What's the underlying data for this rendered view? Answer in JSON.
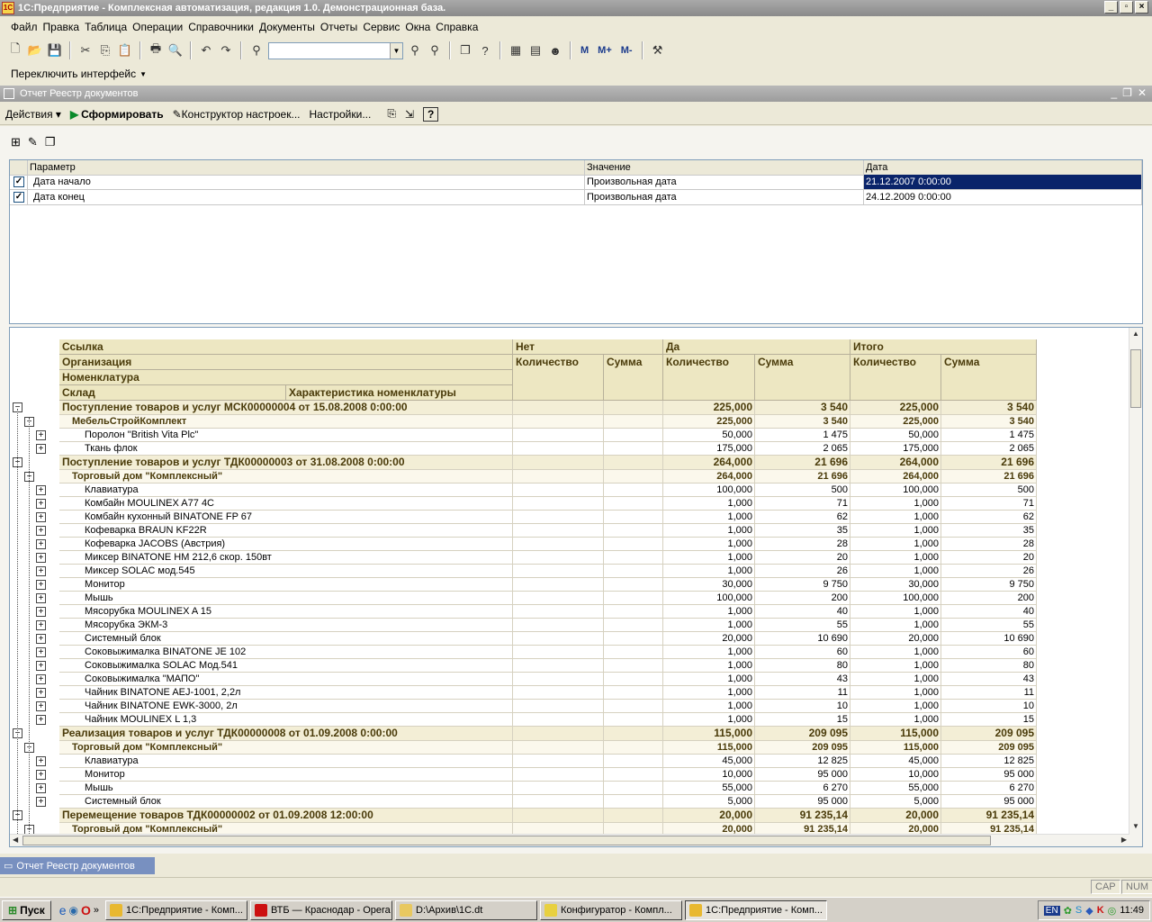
{
  "window": {
    "title": "1С:Предприятие - Комплексная автоматизация, редакция 1.0. Демонстрационная база.",
    "icon_text": "1C"
  },
  "menu": [
    "Файл",
    "Правка",
    "Таблица",
    "Операции",
    "Справочники",
    "Документы",
    "Отчеты",
    "Сервис",
    "Окна",
    "Справка"
  ],
  "toolbar": {
    "search_value": "",
    "m_buttons": [
      "M",
      "M+",
      "M-"
    ],
    "switch_interface": "Переключить интерфейс"
  },
  "subwindow": {
    "title": "Отчет  Реестр документов"
  },
  "actions": {
    "actions": "Действия",
    "generate": "Сформировать",
    "constructor": "Конструктор настроек...",
    "settings": "Настройки...",
    "help": "?"
  },
  "params": {
    "headers": [
      "Параметр",
      "Значение",
      "Дата"
    ],
    "rows": [
      {
        "checked": true,
        "name": "Дата начало",
        "value": "Произвольная дата",
        "date": "21.12.2007 0:00:00"
      },
      {
        "checked": true,
        "name": "Дата конец",
        "value": "Произвольная дата",
        "date": "24.12.2009 0:00:00"
      }
    ]
  },
  "report": {
    "headers": {
      "link": "Ссылка",
      "org": "Организация",
      "nom": "Номенклатура",
      "store": "Склад",
      "char": "Характеристика номенклатуры",
      "no": "Нет",
      "yes": "Да",
      "total": "Итого",
      "qty": "Количество",
      "sum": "Сумма"
    },
    "rows": [
      {
        "lvl": 0,
        "t": "Поступление товаров и услуг МСК00000004 от 15.08.2008 0:00:00",
        "n1": "",
        "s1": "",
        "n2": "225,000",
        "s2": "3 540",
        "n3": "225,000",
        "s3": "3 540"
      },
      {
        "lvl": 1,
        "t": "МебельСтройКомплект",
        "n1": "",
        "s1": "",
        "n2": "225,000",
        "s2": "3 540",
        "n3": "225,000",
        "s3": "3 540"
      },
      {
        "lvl": 2,
        "t": "Поролон \"British Vita Plc\"",
        "n1": "",
        "s1": "",
        "n2": "50,000",
        "s2": "1 475",
        "n3": "50,000",
        "s3": "1 475"
      },
      {
        "lvl": 2,
        "t": "Ткань флок",
        "n1": "",
        "s1": "",
        "n2": "175,000",
        "s2": "2 065",
        "n3": "175,000",
        "s3": "2 065"
      },
      {
        "lvl": 0,
        "t": "Поступление товаров и услуг ТДК00000003 от 31.08.2008 0:00:00",
        "n1": "",
        "s1": "",
        "n2": "264,000",
        "s2": "21 696",
        "n3": "264,000",
        "s3": "21 696"
      },
      {
        "lvl": 1,
        "t": "Торговый дом \"Комплексный\"",
        "n1": "",
        "s1": "",
        "n2": "264,000",
        "s2": "21 696",
        "n3": "264,000",
        "s3": "21 696"
      },
      {
        "lvl": 2,
        "t": "Клавиатура",
        "n1": "",
        "s1": "",
        "n2": "100,000",
        "s2": "500",
        "n3": "100,000",
        "s3": "500"
      },
      {
        "lvl": 2,
        "t": "Комбайн MOULINEX  A77 4C",
        "n1": "",
        "s1": "",
        "n2": "1,000",
        "s2": "71",
        "n3": "1,000",
        "s3": "71"
      },
      {
        "lvl": 2,
        "t": "Комбайн кухонный BINATONE FP 67",
        "n1": "",
        "s1": "",
        "n2": "1,000",
        "s2": "62",
        "n3": "1,000",
        "s3": "62"
      },
      {
        "lvl": 2,
        "t": "Кофеварка BRAUN KF22R",
        "n1": "",
        "s1": "",
        "n2": "1,000",
        "s2": "35",
        "n3": "1,000",
        "s3": "35"
      },
      {
        "lvl": 2,
        "t": "Кофеварка JACOBS (Австрия)",
        "n1": "",
        "s1": "",
        "n2": "1,000",
        "s2": "28",
        "n3": "1,000",
        "s3": "28"
      },
      {
        "lvl": 2,
        "t": "Миксер BINATONE HM 212,6 скор. 150вт",
        "n1": "",
        "s1": "",
        "n2": "1,000",
        "s2": "20",
        "n3": "1,000",
        "s3": "20"
      },
      {
        "lvl": 2,
        "t": "Миксер SOLAC мод.545",
        "n1": "",
        "s1": "",
        "n2": "1,000",
        "s2": "26",
        "n3": "1,000",
        "s3": "26"
      },
      {
        "lvl": 2,
        "t": "Монитор",
        "n1": "",
        "s1": "",
        "n2": "30,000",
        "s2": "9 750",
        "n3": "30,000",
        "s3": "9 750"
      },
      {
        "lvl": 2,
        "t": "Мышь",
        "n1": "",
        "s1": "",
        "n2": "100,000",
        "s2": "200",
        "n3": "100,000",
        "s3": "200"
      },
      {
        "lvl": 2,
        "t": "Мясорубка MOULINEX  A 15",
        "n1": "",
        "s1": "",
        "n2": "1,000",
        "s2": "40",
        "n3": "1,000",
        "s3": "40"
      },
      {
        "lvl": 2,
        "t": "Мясорубка ЭКМ-3",
        "n1": "",
        "s1": "",
        "n2": "1,000",
        "s2": "55",
        "n3": "1,000",
        "s3": "55"
      },
      {
        "lvl": 2,
        "t": "Системный блок",
        "n1": "",
        "s1": "",
        "n2": "20,000",
        "s2": "10 690",
        "n3": "20,000",
        "s3": "10 690"
      },
      {
        "lvl": 2,
        "t": "Соковыжималка  BINATONE JE 102",
        "n1": "",
        "s1": "",
        "n2": "1,000",
        "s2": "60",
        "n3": "1,000",
        "s3": "60"
      },
      {
        "lvl": 2,
        "t": "Соковыжималка  SOLAC  Мод.541",
        "n1": "",
        "s1": "",
        "n2": "1,000",
        "s2": "80",
        "n3": "1,000",
        "s3": "80"
      },
      {
        "lvl": 2,
        "t": "Соковыжималка \"МАПО\"",
        "n1": "",
        "s1": "",
        "n2": "1,000",
        "s2": "43",
        "n3": "1,000",
        "s3": "43"
      },
      {
        "lvl": 2,
        "t": "Чайник BINATONE  AEJ-1001,  2,2л",
        "n1": "",
        "s1": "",
        "n2": "1,000",
        "s2": "11",
        "n3": "1,000",
        "s3": "11"
      },
      {
        "lvl": 2,
        "t": "Чайник BINATONE  EWK-3000,  2л",
        "n1": "",
        "s1": "",
        "n2": "1,000",
        "s2": "10",
        "n3": "1,000",
        "s3": "10"
      },
      {
        "lvl": 2,
        "t": "Чайник MOULINEX L 1,3",
        "n1": "",
        "s1": "",
        "n2": "1,000",
        "s2": "15",
        "n3": "1,000",
        "s3": "15"
      },
      {
        "lvl": 0,
        "t": "Реализация товаров и услуг ТДК00000008 от 01.09.2008 0:00:00",
        "n1": "",
        "s1": "",
        "n2": "115,000",
        "s2": "209 095",
        "n3": "115,000",
        "s3": "209 095"
      },
      {
        "lvl": 1,
        "t": "Торговый дом \"Комплексный\"",
        "n1": "",
        "s1": "",
        "n2": "115,000",
        "s2": "209 095",
        "n3": "115,000",
        "s3": "209 095"
      },
      {
        "lvl": 2,
        "t": "Клавиатура",
        "n1": "",
        "s1": "",
        "n2": "45,000",
        "s2": "12 825",
        "n3": "45,000",
        "s3": "12 825"
      },
      {
        "lvl": 2,
        "t": "Монитор",
        "n1": "",
        "s1": "",
        "n2": "10,000",
        "s2": "95 000",
        "n3": "10,000",
        "s3": "95 000"
      },
      {
        "lvl": 2,
        "t": "Мышь",
        "n1": "",
        "s1": "",
        "n2": "55,000",
        "s2": "6 270",
        "n3": "55,000",
        "s3": "6 270"
      },
      {
        "lvl": 2,
        "t": "Системный блок",
        "n1": "",
        "s1": "",
        "n2": "5,000",
        "s2": "95 000",
        "n3": "5,000",
        "s3": "95 000"
      },
      {
        "lvl": 0,
        "t": "Перемещение товаров ТДК00000002 от 01.09.2008 12:00:00",
        "n1": "",
        "s1": "",
        "n2": "20,000",
        "s2": "91 235,14",
        "n3": "20,000",
        "s3": "91 235,14"
      },
      {
        "lvl": 1,
        "t": "Торговый дом \"Комплексный\"",
        "n1": "",
        "s1": "",
        "n2": "20,000",
        "s2": "91 235,14",
        "n3": "20,000",
        "s3": "91 235,14"
      }
    ]
  },
  "window_tab": "Отчет  Реестр документов",
  "status": {
    "cap": "CAP",
    "num": "NUM"
  },
  "taskbar": {
    "start": "Пуск",
    "items": [
      {
        "label": "1С:Предприятие - Комп...",
        "color": "#e8b830",
        "active": false
      },
      {
        "label": "ВТБ — Краснодар - Opera",
        "color": "#cc1010",
        "active": false
      },
      {
        "label": "D:\\Архив\\1C.dt",
        "color": "#e8c860",
        "active": false
      },
      {
        "label": "Конфигуратор - Компл...",
        "color": "#e8d040",
        "active": false
      },
      {
        "label": "1С:Предприятие - Комп...",
        "color": "#e8b830",
        "active": true
      }
    ],
    "lang": "EN",
    "clock": "11:49"
  }
}
